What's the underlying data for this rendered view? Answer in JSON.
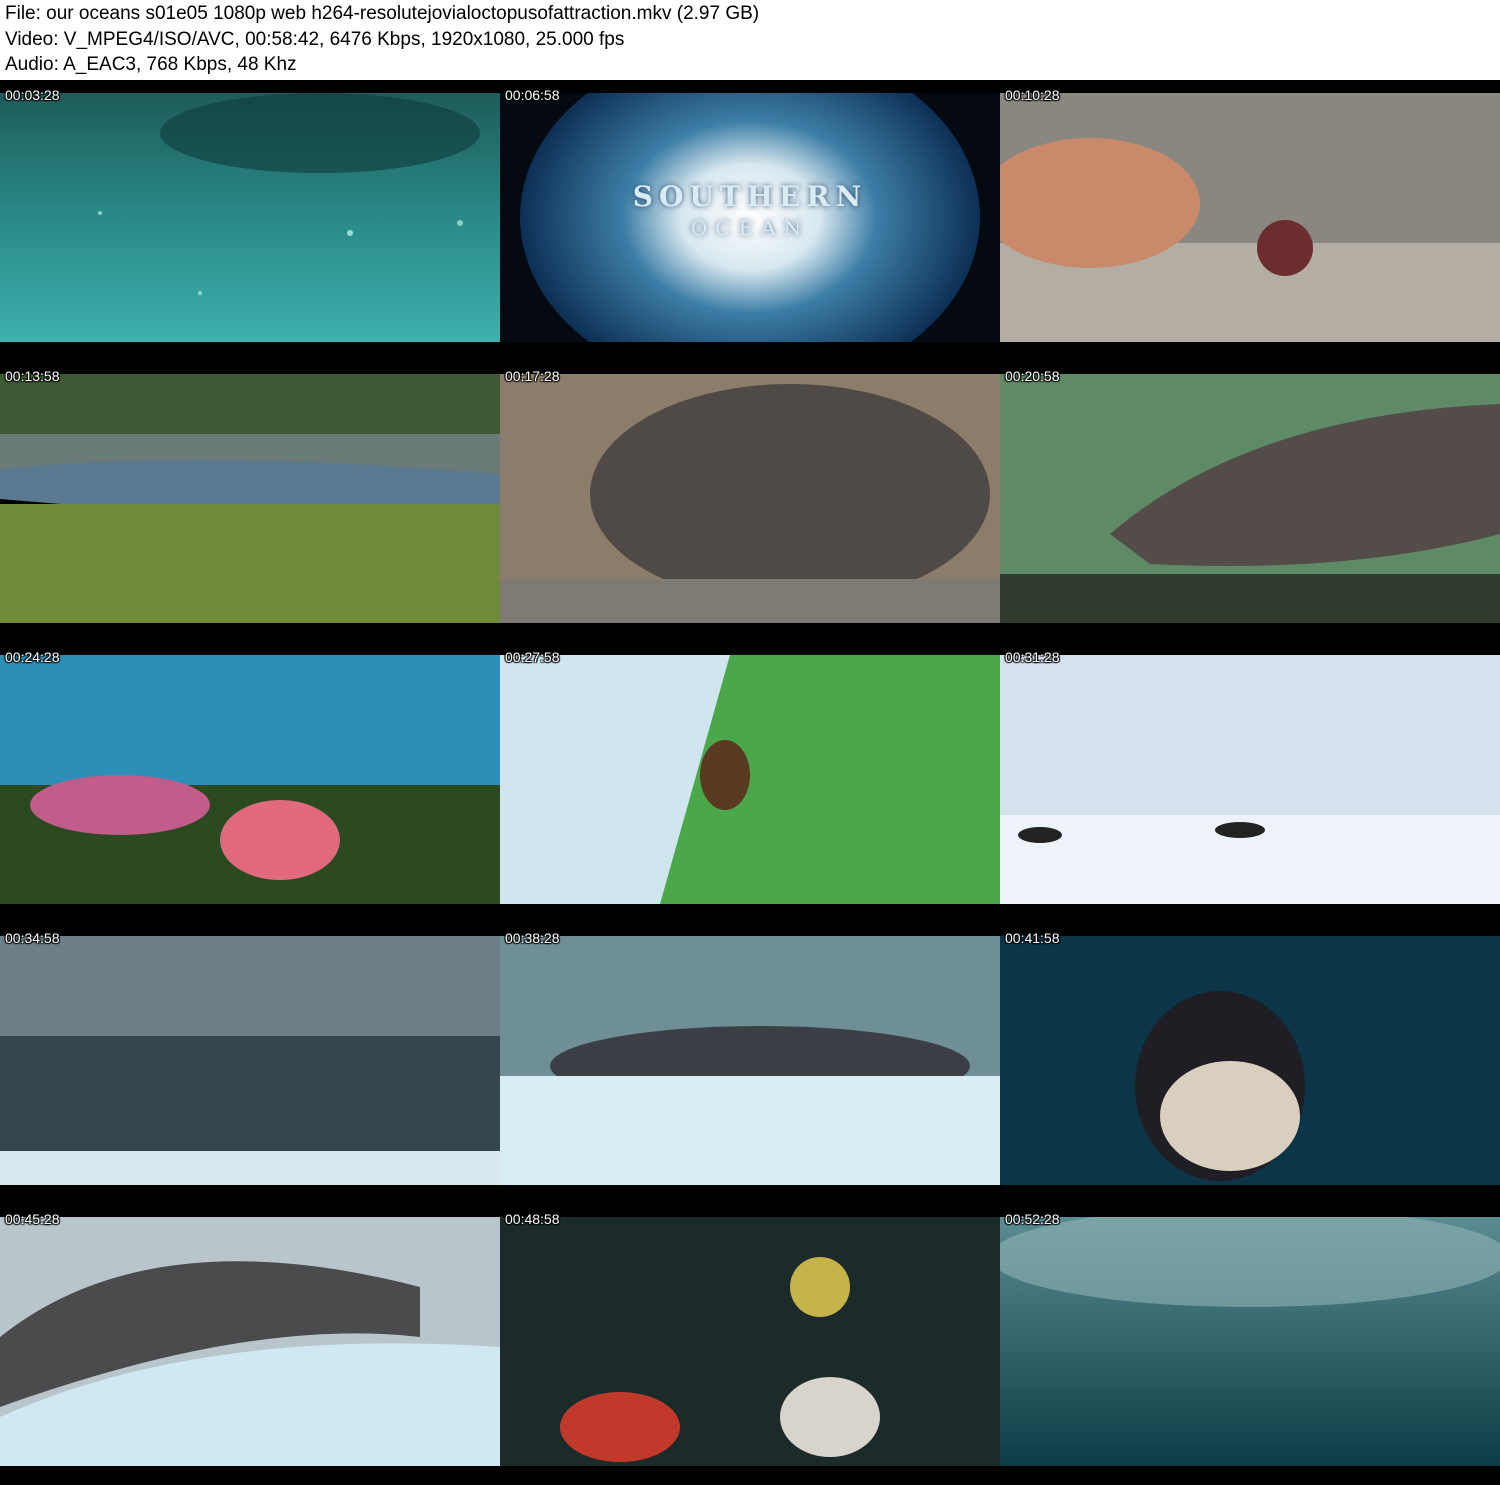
{
  "header": {
    "file_line": "File: our oceans s01e05 1080p web h264-resolutejovialoctopusofattraction.mkv (2.97 GB)",
    "video_line": "Video: V_MPEG4/ISO/AVC, 00:58:42, 6476 Kbps, 1920x1080, 25.000 fps",
    "audio_line": "Audio: A_EAC3, 768 Kbps, 48 Khz"
  },
  "thumbnails": [
    {
      "timestamp": "00:03:28",
      "scene": "underwater-bubbles-teal"
    },
    {
      "timestamp": "00:06:58",
      "scene": "globe-southern-ocean",
      "title_line1": "SOUTHERN",
      "title_line2": "OCEAN"
    },
    {
      "timestamp": "00:10:28",
      "scene": "fish-on-seabed"
    },
    {
      "timestamp": "00:13:58",
      "scene": "coastal-bay-grassland"
    },
    {
      "timestamp": "00:17:28",
      "scene": "elephant-seal-face"
    },
    {
      "timestamp": "00:20:58",
      "scene": "seal-flippers-underwater"
    },
    {
      "timestamp": "00:24:28",
      "scene": "starfish-seafloor"
    },
    {
      "timestamp": "00:27:58",
      "scene": "krill-closeup"
    },
    {
      "timestamp": "00:31:28",
      "scene": "penguins-on-ice"
    },
    {
      "timestamp": "00:34:58",
      "scene": "antarctic-bay-storm"
    },
    {
      "timestamp": "00:38:28",
      "scene": "seal-resting-on-ice"
    },
    {
      "timestamp": "00:41:58",
      "scene": "orca-underwater"
    },
    {
      "timestamp": "00:45:28",
      "scene": "seal-on-ice-closeup"
    },
    {
      "timestamp": "00:48:58",
      "scene": "reef-invertebrates"
    },
    {
      "timestamp": "00:52:28",
      "scene": "underwater-splash"
    }
  ]
}
